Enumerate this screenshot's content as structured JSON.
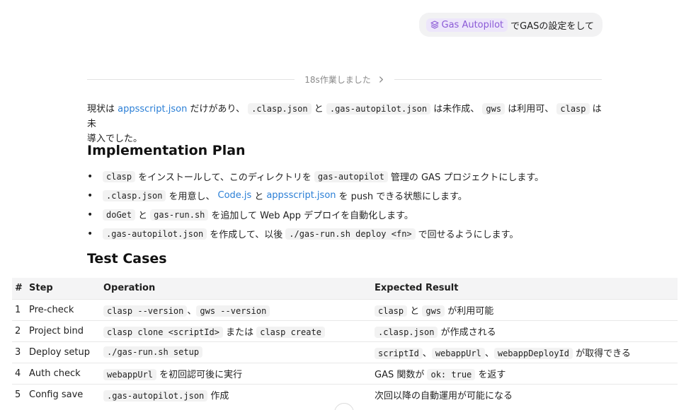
{
  "user_message": {
    "chip_label": "Gas Autopilot",
    "text": "でGASの設定をして"
  },
  "work_summary": {
    "label": "18s作業しました"
  },
  "intro": {
    "t1": "現状は ",
    "link1": "appsscript.json",
    "t2": " だけがあり、",
    "code1": ".clasp.json",
    "t3": " と ",
    "code2": ".gas-autopilot.json",
    "t4": " は未作成、",
    "code3": "gws",
    "t5": " は利用可、",
    "code4": "clasp",
    "t6": " は未",
    "t7": "導入でした。"
  },
  "implementation_plan": {
    "heading": "Implementation Plan",
    "items": [
      {
        "c1": "clasp",
        "t1": " をインストールして、このディレクトリを ",
        "c2": "gas-autopilot",
        "t2": " 管理の GAS プロジェクトにします。"
      },
      {
        "c1": ".clasp.json",
        "t1": " を用意し、",
        "l1": "Code.js",
        "t2": " と ",
        "l2": "appsscript.json",
        "t3": " を push できる状態にします。"
      },
      {
        "c1": "doGet",
        "t1": " と ",
        "c2": "gas-run.sh",
        "t2": " を追加して Web App デプロイを自動化します。"
      },
      {
        "c1": ".gas-autopilot.json",
        "t1": " を作成して、以後 ",
        "c2": "./gas-run.sh deploy <fn>",
        "t2": " で回せるようにします。"
      }
    ]
  },
  "test_cases": {
    "heading": "Test Cases",
    "columns": [
      "#",
      "Step",
      "Operation",
      "Expected Result"
    ],
    "rows": [
      {
        "num": "1",
        "step": "Pre-check",
        "op": {
          "c1": "clasp --version",
          "t1": "、",
          "c2": "gws --version"
        },
        "res": {
          "c1": "clasp",
          "t1": " と ",
          "c2": "gws",
          "t2": " が利用可能"
        }
      },
      {
        "num": "2",
        "step": "Project bind",
        "op": {
          "c1": "clasp clone <scriptId>",
          "t1": " または ",
          "c2": "clasp create"
        },
        "res": {
          "c1": ".clasp.json",
          "t1": " が作成される"
        }
      },
      {
        "num": "3",
        "step": "Deploy setup",
        "op": {
          "c1": "./gas-run.sh setup"
        },
        "res": {
          "c1": "scriptId",
          "t1": "、",
          "c2": "webappUrl",
          "t2": "、",
          "c3": "webappDeployId",
          "t3": " が取得できる"
        }
      },
      {
        "num": "4",
        "step": "Auth check",
        "op": {
          "c1": "webappUrl",
          "t1": " を初回認可後に実行"
        },
        "res": {
          "t0": "GAS 関数が ",
          "c1": "ok: true",
          "t1": " を返す"
        }
      },
      {
        "num": "5",
        "step": "Config save",
        "op": {
          "c1": ".gas-autopilot.json",
          "t1": " 作成"
        },
        "res": {
          "t0": "次回以降の自動運用が可能になる"
        }
      }
    ]
  }
}
